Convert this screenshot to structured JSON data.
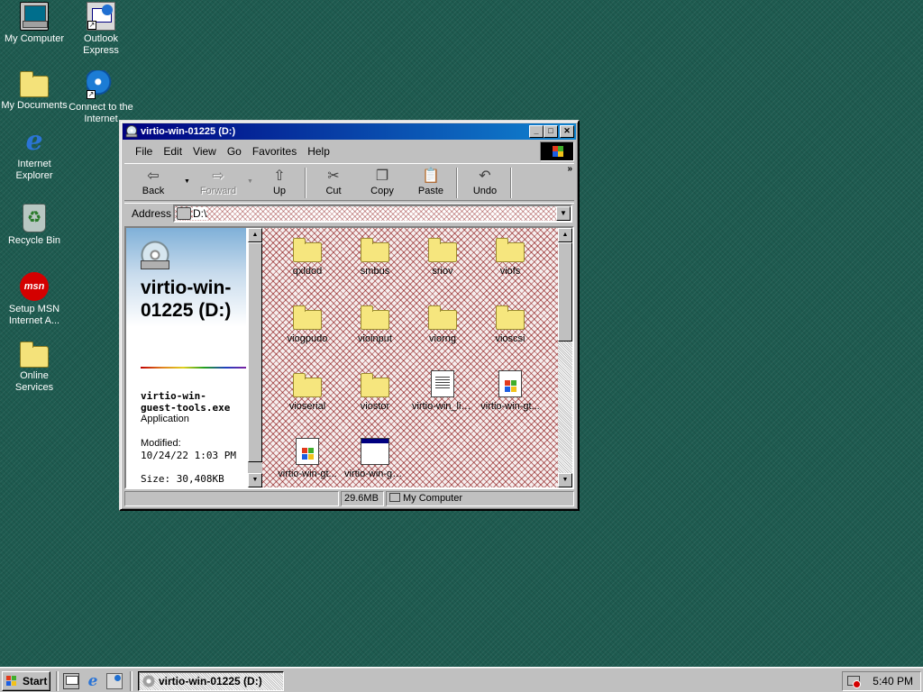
{
  "desktop": {
    "icons": [
      {
        "label": "My Computer",
        "icon": "my-computer-icon"
      },
      {
        "label": "Outlook Express",
        "icon": "outlook-express-icon"
      },
      {
        "label": "My Documents",
        "icon": "folder-icon"
      },
      {
        "label": "Connect to the Internet",
        "icon": "connect-internet-icon"
      },
      {
        "label": "Internet Explorer",
        "icon": "internet-explorer-icon"
      },
      {
        "label": "Recycle Bin",
        "icon": "recycle-bin-icon"
      },
      {
        "label": "Setup MSN Internet A...",
        "icon": "msn-icon",
        "glyph_text": "msn"
      },
      {
        "label": "Online Services",
        "icon": "folder-icon"
      }
    ],
    "background_color": "#1e5b50"
  },
  "window": {
    "title": "virtio-win-01225 (D:)",
    "menu": [
      "File",
      "Edit",
      "View",
      "Go",
      "Favorites",
      "Help"
    ],
    "toolbar": {
      "back": "Back",
      "forward": "Forward",
      "up": "Up",
      "cut": "Cut",
      "copy": "Copy",
      "paste": "Paste",
      "undo": "Undo",
      "more": "»"
    },
    "address": {
      "label": "Address",
      "value": "D:\\"
    },
    "info_pane": {
      "drive_title": "virtio-win-01225 (D:)",
      "selected_name": "virtio-win-guest-tools.exe",
      "selected_type": "Application",
      "modified_label": "Modified:",
      "modified_value": "10/24/22 1:03 PM",
      "size_line": "Size: 30,408KB"
    },
    "files": [
      {
        "name": "qxldod",
        "type": "folder"
      },
      {
        "name": "smbus",
        "type": "folder"
      },
      {
        "name": "sriov",
        "type": "folder"
      },
      {
        "name": "viofs",
        "type": "folder"
      },
      {
        "name": "viogpudo",
        "type": "folder"
      },
      {
        "name": "vioinput",
        "type": "folder"
      },
      {
        "name": "viorng",
        "type": "folder"
      },
      {
        "name": "vioscsi",
        "type": "folder"
      },
      {
        "name": "vioserial",
        "type": "folder"
      },
      {
        "name": "viostor",
        "type": "folder"
      },
      {
        "name": "virtio-win_lic...",
        "type": "text"
      },
      {
        "name": "virtio-win-gt...",
        "type": "setup"
      },
      {
        "name": "virtio-win-gt...",
        "type": "setup"
      },
      {
        "name": "virtio-win-gu...",
        "type": "exe"
      }
    ],
    "status": {
      "size": "29.6MB",
      "location": "My Computer"
    }
  },
  "taskbar": {
    "start_label": "Start",
    "quick_launch": [
      "show-desktop-icon",
      "internet-explorer-icon",
      "outlook-express-icon"
    ],
    "task_button": "virtio-win-01225 (D:)",
    "clock": "5:40 PM"
  }
}
